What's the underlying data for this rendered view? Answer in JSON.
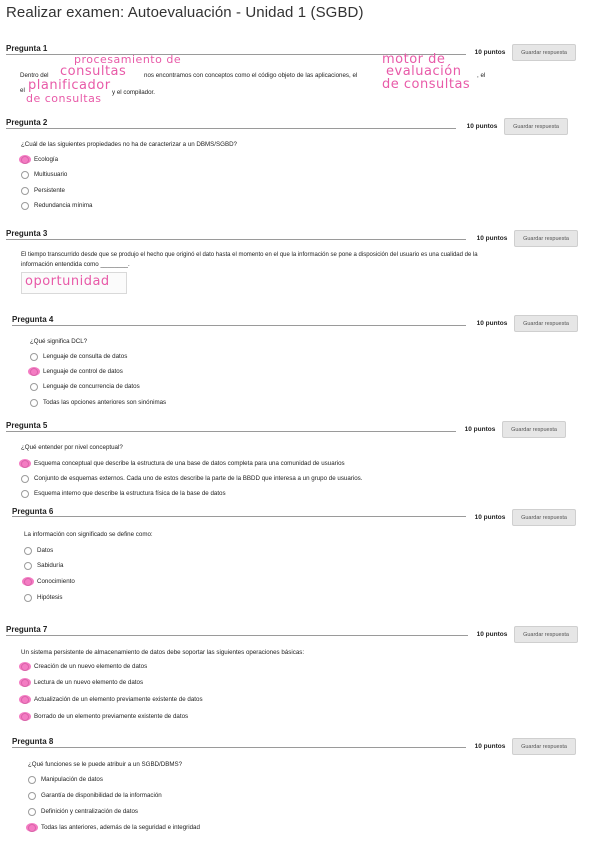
{
  "page": {
    "title": "Realizar examen: Autoevaluación - Unidad 1 (SGBD)"
  },
  "colors": {
    "annotation_pink": "#e85aa8",
    "button_bg": "#e6e6e6",
    "rule_gray": "#9a9a9a"
  },
  "questions": [
    {
      "label": "Pregunta 1",
      "points": "10 puntos",
      "save": "Guardar respuesta",
      "text_a": "Dentro del",
      "text_b": "nos encontramos con conceptos como el código objeto de las aplicaciones, el",
      "text_c": ", el",
      "text_d": "el",
      "text_e": "y el compilador.",
      "hw_1": "procesamiento de",
      "hw_2": "consultas",
      "hw_3": "motor de",
      "hw_4": "evaluación",
      "hw_5": "de consultas",
      "hw_6": "planificador",
      "hw_7": "de consultas"
    },
    {
      "label": "Pregunta 2",
      "points": "10 puntos",
      "save": "Guardar respuesta",
      "text": "¿Cuál de las siguientes propiedades no ha de caracterizar a un DBMS/SGBD?",
      "options": [
        "Ecología",
        "Multiusuario",
        "Persistente",
        "Redundancia mínima"
      ]
    },
    {
      "label": "Pregunta 3",
      "points": "10 puntos",
      "save": "Guardar respuesta",
      "text_1": "El tiempo transcurrido desde que se produjo el hecho que originó el dato hasta el momento en el que la información se pone a disposición del usuario es una cualidad de la",
      "text_2": "información entendida como ________.",
      "answer": "oportunidad"
    },
    {
      "label": "Pregunta 4",
      "points": "10 puntos",
      "save": "Guardar respuesta",
      "text": "¿Qué significa DCL?",
      "options": [
        "Lenguaje de consulta de datos",
        "Lenguaje de control de datos",
        "Lenguaje de concurrencia de datos",
        "Todas las opciones anteriores son sinónimas"
      ]
    },
    {
      "label": "Pregunta 5",
      "points": "10 puntos",
      "save": "Guardar respuesta",
      "text": "¿Qué entender por nivel conceptual?",
      "options": [
        "Esquema conceptual que describe la estructura de una base de datos completa para una comunidad de usuarios",
        "Conjunto de esquemas externos. Cada uno de estos describe la parte de la BBDD que interesa a un grupo de usuarios.",
        "Esquema interno que describe la estructura física de la base de datos"
      ]
    },
    {
      "label": "Pregunta 6",
      "points": "10 puntos",
      "save": "Guardar respuesta",
      "text": "La información con significado se define como:",
      "options": [
        "Datos",
        "Sabiduría",
        "Conocimiento",
        "Hipótesis"
      ]
    },
    {
      "label": "Pregunta 7",
      "points": "10 puntos",
      "save": "Guardar respuesta",
      "text": "Un sistema persistente de almacenamiento de datos debe soportar las siguientes operaciones básicas:",
      "options": [
        "Creación de un nuevo elemento de datos",
        "Lectura de un nuevo elemento de datos",
        "Actualización de un elemento previamente existente de datos",
        "Borrado de un elemento previamente existente de datos"
      ]
    },
    {
      "label": "Pregunta 8",
      "points": "10 puntos",
      "save": "Guardar respuesta",
      "text": "¿Qué funciones se le puede atribuir a un SGBD/DBMS?",
      "options": [
        "Manipulación de datos",
        "Garantía de disponibilidad de la información",
        "Definición y centralización de datos",
        "Todas las anteriores, además de la seguridad e integridad"
      ]
    }
  ]
}
